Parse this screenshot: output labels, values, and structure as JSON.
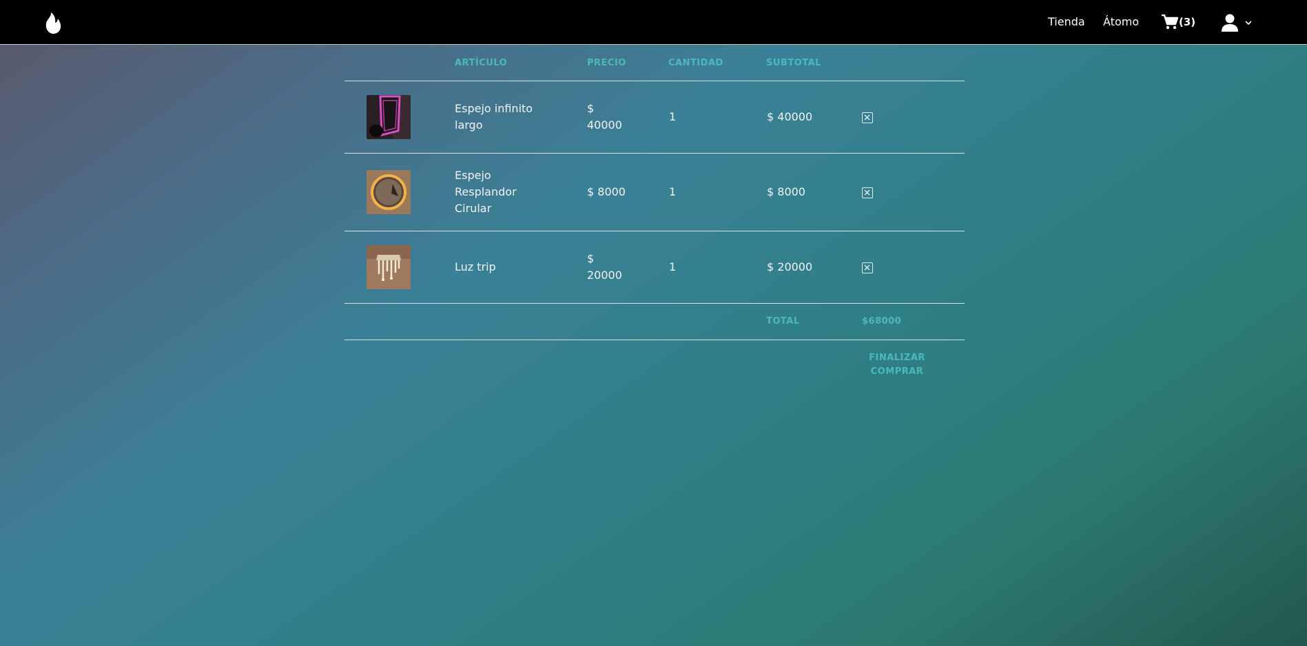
{
  "nav": {
    "links": [
      "Tienda",
      "Átomo"
    ],
    "cart_count": "(3)"
  },
  "table": {
    "headers": [
      "ARTÍCULO",
      "PRECIO",
      "CANTIDAD",
      "SUBTOTAL"
    ],
    "rows": [
      {
        "name_lines": [
          "Espejo infinito",
          "largo"
        ],
        "price_lines": [
          "$",
          "40000"
        ],
        "quantity": "1",
        "subtotal": "$ 40000"
      },
      {
        "name_lines": [
          "Espejo",
          "Resplandor",
          "Cirular"
        ],
        "price_lines": [
          "$ 8000"
        ],
        "quantity": "1",
        "subtotal": "$ 8000"
      },
      {
        "name_lines": [
          "Luz trip"
        ],
        "price_lines": [
          "$",
          "20000"
        ],
        "quantity": "1",
        "subtotal": "$ 20000"
      }
    ],
    "total_label": "TOTAL",
    "total_value": "$68000",
    "checkout_lines": [
      "FINALIZAR",
      "COMPRAR"
    ]
  },
  "colors": {
    "accent": "#4cb8bd",
    "navbar": "#000000",
    "text": "#f2f4f5"
  },
  "icons": {
    "logo": "flame-icon",
    "cart": "cart-icon",
    "user": "user-icon",
    "dropdown": "chevron-down-icon",
    "remove": "remove-item-icon"
  }
}
